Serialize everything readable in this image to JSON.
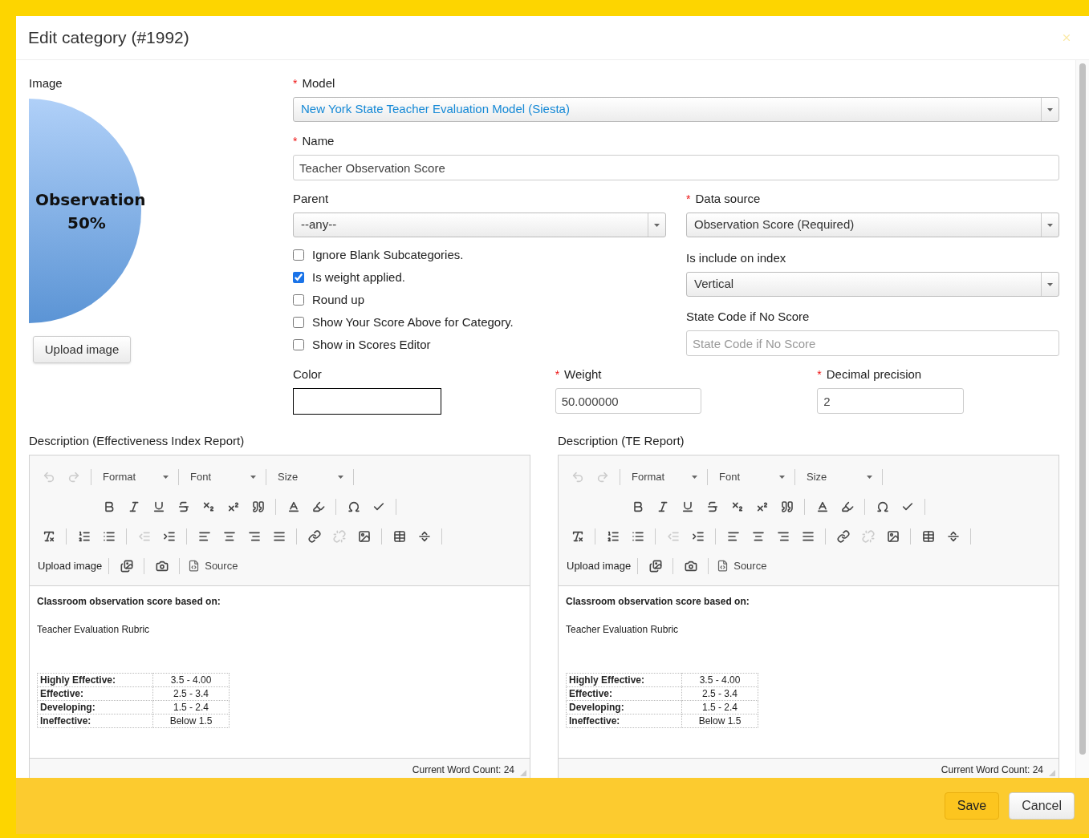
{
  "dialog": {
    "title": "Edit category (#1992)"
  },
  "required_marker": "*",
  "image": {
    "label": "Image",
    "caption_title": "Observation",
    "caption_value": "50%",
    "upload_button": "Upload image"
  },
  "model": {
    "label": "Model",
    "required": true,
    "value": "New York State Teacher Evaluation Model (Siesta)"
  },
  "name": {
    "label": "Name",
    "required": true,
    "value": "Teacher Observation Score"
  },
  "parent": {
    "label": "Parent",
    "required": false,
    "value": "--any--"
  },
  "data_source": {
    "label": "Data source",
    "required": true,
    "value": "Observation Score (Required)"
  },
  "checkboxes": [
    {
      "label": "Ignore Blank Subcategories.",
      "checked": false
    },
    {
      "label": "Is weight applied.",
      "checked": true
    },
    {
      "label": "Round up",
      "checked": false
    },
    {
      "label": "Show Your Score Above for Category.",
      "checked": false
    },
    {
      "label": "Show in Scores Editor",
      "checked": false
    }
  ],
  "include_on_index": {
    "label": "Is include on index",
    "required": false,
    "value": "Vertical"
  },
  "state_code": {
    "label": "State Code if No Score",
    "required": false,
    "placeholder": "State Code if No Score"
  },
  "color": {
    "label": "Color",
    "required": false
  },
  "weight": {
    "label": "Weight",
    "required": true,
    "value": "50.000000"
  },
  "decimal_precision": {
    "label": "Decimal precision",
    "required": true,
    "value": "2"
  },
  "editors": [
    {
      "label": "Description (Effectiveness Index Report)",
      "format": "Format",
      "font": "Font",
      "size": "Size",
      "upload": "Upload image",
      "source": "Source",
      "heading": "Classroom observation score based on:",
      "subtitle": "Teacher Evaluation Rubric",
      "rubric": [
        {
          "level": "Highly Effective:",
          "range": "3.5 - 4.00"
        },
        {
          "level": "Effective:",
          "range": "2.5 - 3.4"
        },
        {
          "level": "Developing:",
          "range": "1.5 - 2.4"
        },
        {
          "level": "Ineffective:",
          "range": "Below 1.5"
        }
      ],
      "word_count": "Current Word Count: 24"
    },
    {
      "label": "Description (TE Report)",
      "format": "Format",
      "font": "Font",
      "size": "Size",
      "upload": "Upload image",
      "source": "Source",
      "heading": "Classroom observation score based on:",
      "subtitle": "Teacher Evaluation Rubric",
      "rubric": [
        {
          "level": "Highly Effective:",
          "range": "3.5 - 4.00"
        },
        {
          "level": "Effective:",
          "range": "2.5 - 3.4"
        },
        {
          "level": "Developing:",
          "range": "1.5 - 2.4"
        },
        {
          "level": "Ineffective:",
          "range": "Below 1.5"
        }
      ],
      "word_count": "Current Word Count: 24"
    }
  ],
  "footer": {
    "buttons": [
      {
        "label": "Save",
        "kind": "primary"
      },
      {
        "label": "Cancel",
        "kind": "default"
      }
    ]
  }
}
